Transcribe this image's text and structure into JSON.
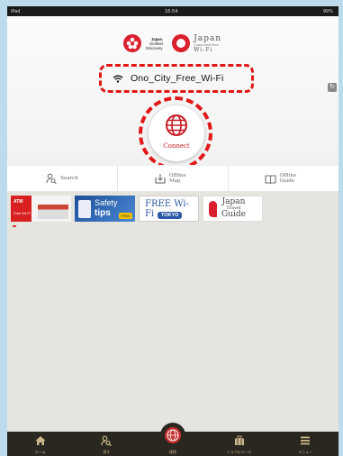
{
  "status_bar": {
    "device": "iPad",
    "time": "16:54",
    "battery": "99%"
  },
  "header": {
    "brand_left": {
      "line1": "Japan.",
      "line2": "Endless",
      "line3": "Discovery."
    },
    "brand_right": {
      "line1": "Japan",
      "line2": "Connected-free",
      "line3": "Wi-Fi"
    }
  },
  "network": {
    "ssid": "Ono_City_Free_Wi-Fi"
  },
  "connect": {
    "label": "Connect"
  },
  "tabs": [
    {
      "label": "Search",
      "icon": "person-search-icon"
    },
    {
      "label": "Offline Map",
      "icon": "map-download-icon"
    },
    {
      "label": "Offline Guide",
      "icon": "book-icon"
    }
  ],
  "banners": [
    {
      "name": "atm",
      "title": "ATM",
      "sub": "Free Wi-Fi"
    },
    {
      "name": "safety-tips",
      "title": "Safety",
      "sub": "tips",
      "badge": "FREE"
    },
    {
      "name": "free-wifi-tokyo",
      "title": "FREE Wi-Fi",
      "sub": "TOKYO"
    },
    {
      "name": "japan-travel-guide",
      "title": "Japan",
      "sub": "Travel",
      "third": "Guide"
    }
  ],
  "bottom_nav": [
    {
      "label": "ホーム",
      "icon": "home-icon"
    },
    {
      "label": "探す",
      "icon": "search-person-icon"
    },
    {
      "label": "接続",
      "icon": "connect-icon"
    },
    {
      "label": "トラベルツール",
      "icon": "suitcase-icon"
    },
    {
      "label": "メニュー",
      "icon": "menu-icon"
    }
  ],
  "colors": {
    "accent": "#e01818",
    "brand_red": "#d8202f",
    "tabbar_bg": "#2a2620",
    "tabbar_fg": "#c9b88a"
  }
}
